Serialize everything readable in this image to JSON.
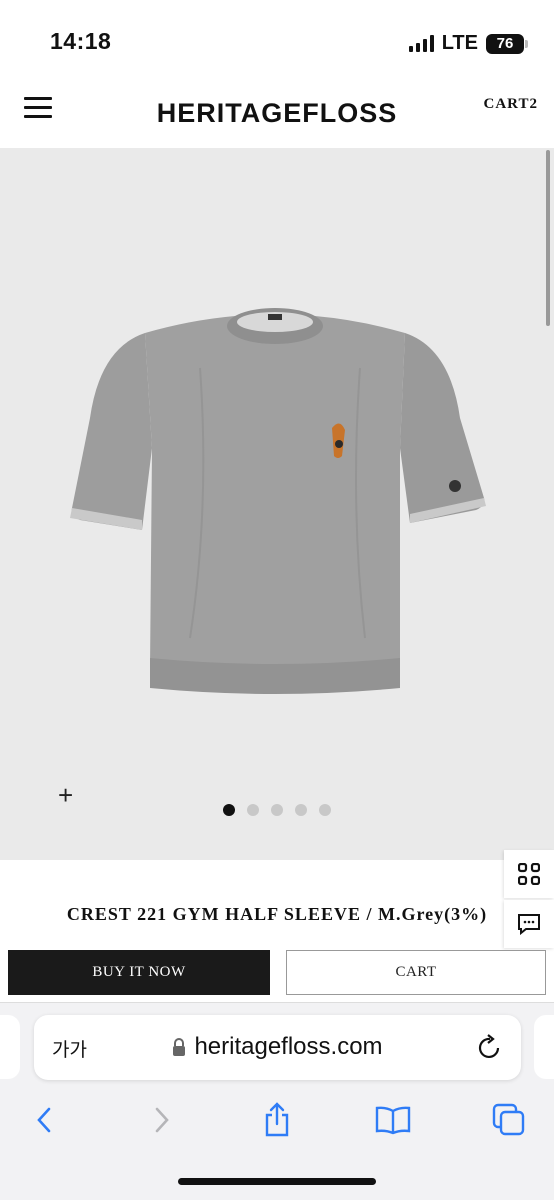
{
  "status_bar": {
    "time": "14:18",
    "network": "LTE",
    "battery": "76"
  },
  "header": {
    "brand": "HERITAGEFLOSS",
    "cart_label": "CART2"
  },
  "gallery": {
    "zoom_symbol": "+",
    "slide_count": 5,
    "active_slide": 1
  },
  "product": {
    "title": "CREST 221 GYM HALF SLEEVE / M.Grey(3%)"
  },
  "actions": {
    "buy_now": "BUY IT NOW",
    "cart": "CART"
  },
  "browser": {
    "text_size_label": "가가",
    "url": "heritagefloss.com"
  },
  "colors": {
    "product_bg": "#eaeaea",
    "buy_button": "#1a1a1a",
    "ios_blue": "#2f7cf6",
    "shirt": "#9a9a9a"
  }
}
